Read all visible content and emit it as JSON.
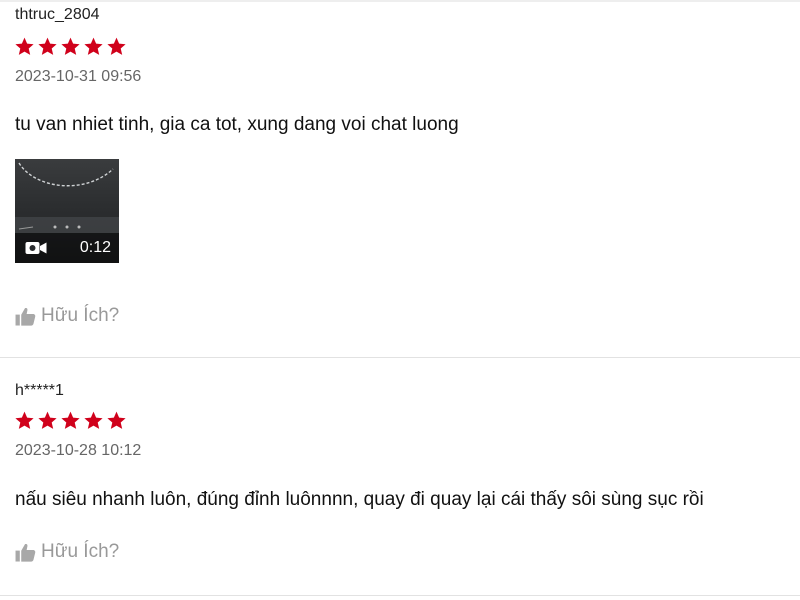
{
  "reviews": [
    {
      "username": "thtruc_2804",
      "rating": 5,
      "date": "2023-10-31 09:56",
      "comment": "tu van nhiet tinh, gia ca tot, xung dang voi chat luong",
      "video": {
        "duration": "0:12",
        "icon": "video-camera-icon"
      },
      "helpful_label": "Hữu Ích?"
    },
    {
      "username": "h*****1",
      "rating": 5,
      "date": "2023-10-28 10:12",
      "comment": "nấu siêu nhanh luôn, đúng đỉnh luônnnn, quay đi quay lại cái thấy sôi sùng sục rồi",
      "helpful_label": "Hữu Ích?"
    }
  ],
  "colors": {
    "star": "#d0011b",
    "helpful": "#999999",
    "date": "#666666"
  },
  "icons": {
    "star": "star-icon",
    "helpful": "thumbs-up-icon"
  }
}
